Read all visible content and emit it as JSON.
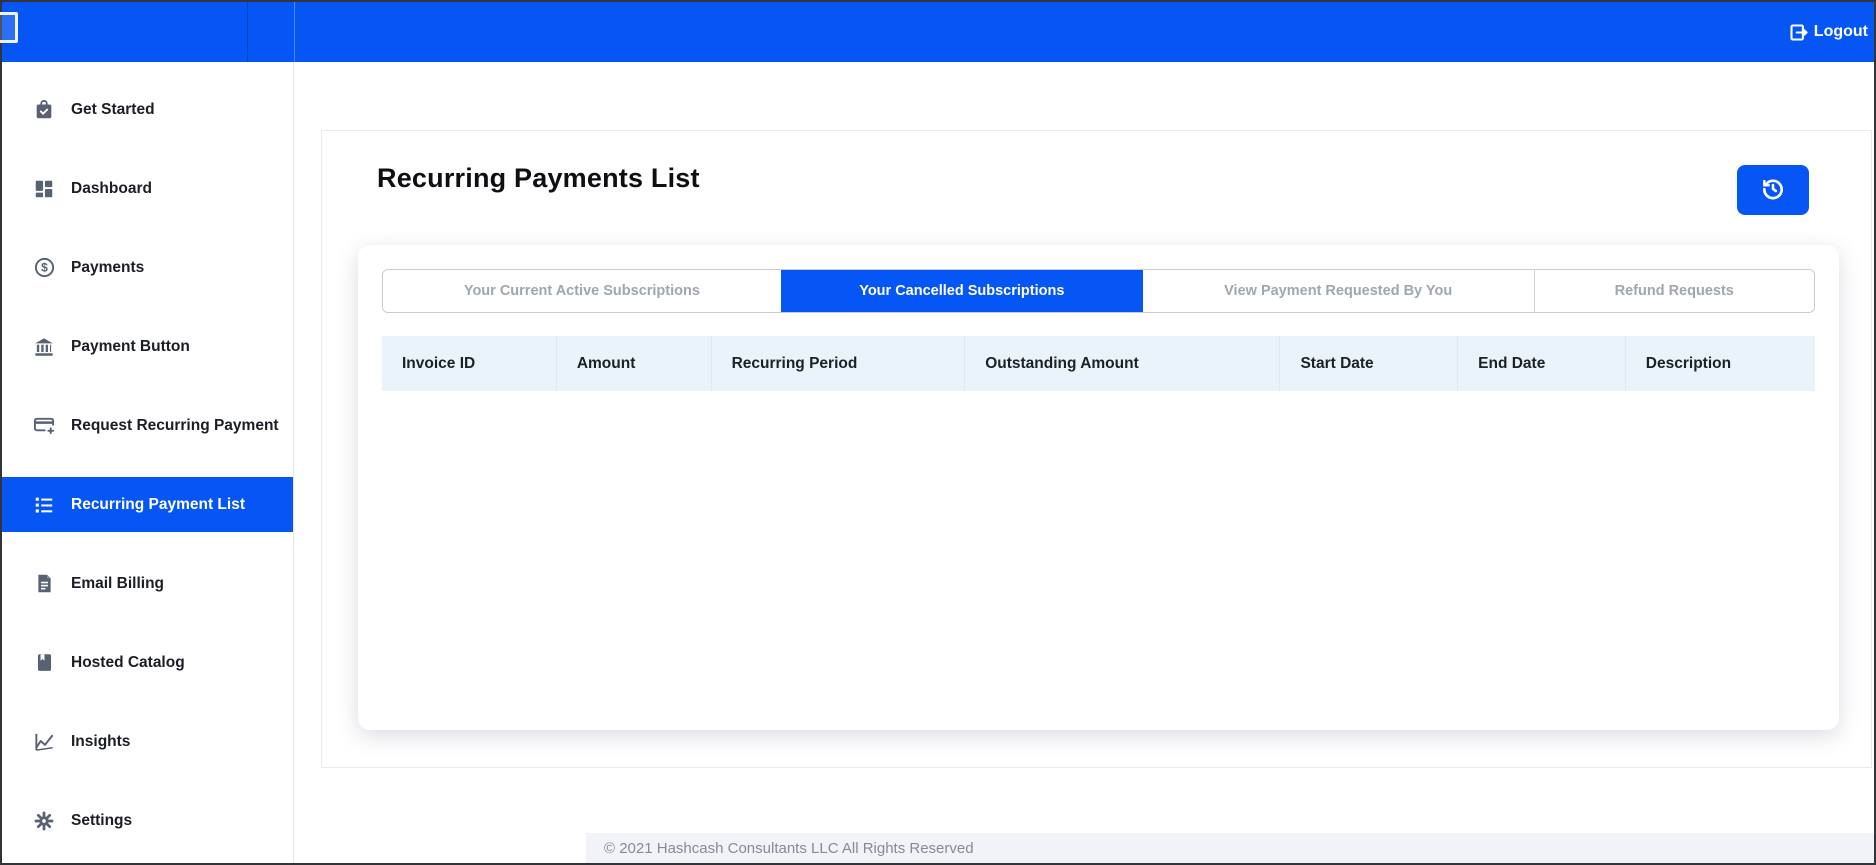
{
  "header": {
    "logout_label": "Logout"
  },
  "sidebar": {
    "items": [
      {
        "label": "Get Started",
        "icon": "get-started-icon",
        "active": false
      },
      {
        "label": "Dashboard",
        "icon": "dashboard-icon",
        "active": false
      },
      {
        "label": "Payments",
        "icon": "payments-icon",
        "active": false
      },
      {
        "label": "Payment Button",
        "icon": "payment-button-icon",
        "active": false
      },
      {
        "label": "Request Recurring Payment",
        "icon": "request-recurring-icon",
        "active": false
      },
      {
        "label": "Recurring Payment List",
        "icon": "recurring-payment-list-icon",
        "active": true
      },
      {
        "label": "Email Billing",
        "icon": "email-billing-icon",
        "active": false
      },
      {
        "label": "Hosted Catalog",
        "icon": "hosted-catalog-icon",
        "active": false
      },
      {
        "label": "Insights",
        "icon": "insights-icon",
        "active": false
      },
      {
        "label": "Settings",
        "icon": "settings-icon",
        "active": false
      }
    ]
  },
  "main": {
    "title": "Recurring Payments List",
    "refresh_button_icon": "history-icon",
    "tabs": [
      {
        "label": "Your Current Active Subscriptions",
        "active": false
      },
      {
        "label": "Your Cancelled Subscriptions",
        "active": true
      },
      {
        "label": "View Payment Requested By You",
        "active": false
      },
      {
        "label": "Refund Requests",
        "active": false
      }
    ],
    "table": {
      "columns": [
        "Invoice ID",
        "Amount",
        "Recurring Period",
        "Outstanding Amount",
        "Start Date",
        "End Date",
        "Description"
      ],
      "rows": []
    }
  },
  "footer": {
    "copyright": "© 2021 Hashcash Consultants LLC All Rights Reserved"
  },
  "colors": {
    "primary_blue": "#0556f5",
    "table_header_bg": "#eaf2fc",
    "sidebar_icon": "#596273",
    "inactive_tab_text": "#a1a7ae",
    "footer_bg": "#f1f3f7"
  }
}
